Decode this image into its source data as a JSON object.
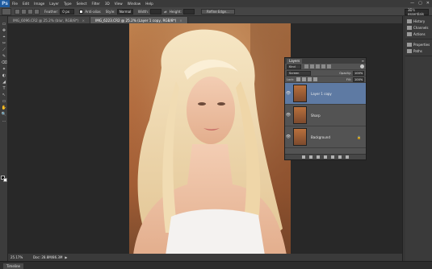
{
  "app": {
    "logo": "Ps"
  },
  "menu": [
    "File",
    "Edit",
    "Image",
    "Layer",
    "Type",
    "Select",
    "Filter",
    "3D",
    "View",
    "Window",
    "Help"
  ],
  "window_controls": [
    "—",
    "▢",
    "✕"
  ],
  "options": {
    "feather_label": "Feather:",
    "feather_value": "0 px",
    "antialias_label": "Anti-alias",
    "style_label": "Style:",
    "style_value": "Normal",
    "width_label": "Width:",
    "height_label": "Height:",
    "refine_edge": "Refine Edge...",
    "workspace": "3D's essentials"
  },
  "tabs": [
    {
      "label": "IMG_6096.CR2 @ 25.2% (blur, RGB/8*)",
      "active": false
    },
    {
      "label": "IMG_6223.CR2 @ 25.2% (Layer 1 copy, RGB/8*)",
      "active": true
    }
  ],
  "tools": [
    "▭",
    "✥",
    "⌖",
    "✂",
    "⟋",
    "✎",
    "⌫",
    "✦",
    "◐",
    "◢",
    "T",
    "↖",
    "▭",
    "✋",
    "🔍",
    "…"
  ],
  "layers_panel": {
    "tab": "Layers",
    "kind": "Kind",
    "blend_mode": "Screen",
    "opacity_label": "Opacity:",
    "opacity": "100%",
    "lock_label": "Lock:",
    "fill_label": "Fill:",
    "fill": "100%",
    "layers": [
      {
        "name": "Layer 1 copy",
        "selected": true,
        "visible": true
      },
      {
        "name": "Sharp",
        "selected": false,
        "visible": true
      },
      {
        "name": "Background",
        "selected": false,
        "visible": true,
        "locked": true
      }
    ]
  },
  "right_panel": {
    "groups": [
      [
        "History",
        "Channels",
        "Actions"
      ],
      [
        "Properties",
        "Paths"
      ]
    ],
    "icons": [
      "history-icon",
      "channels-icon",
      "actions-icon",
      "properties-icon",
      "paths-icon"
    ]
  },
  "status": {
    "zoom": "25.17%",
    "doc": "Doc: 28.8M/86.3M",
    "arrow": "▶"
  },
  "timeline_tab": "Timeline",
  "colors": {
    "ui_dark": "#2b2b2b",
    "panel": "#535353",
    "selected_layer": "#5e7aa3",
    "ps_blue": "#1f5b9e"
  }
}
